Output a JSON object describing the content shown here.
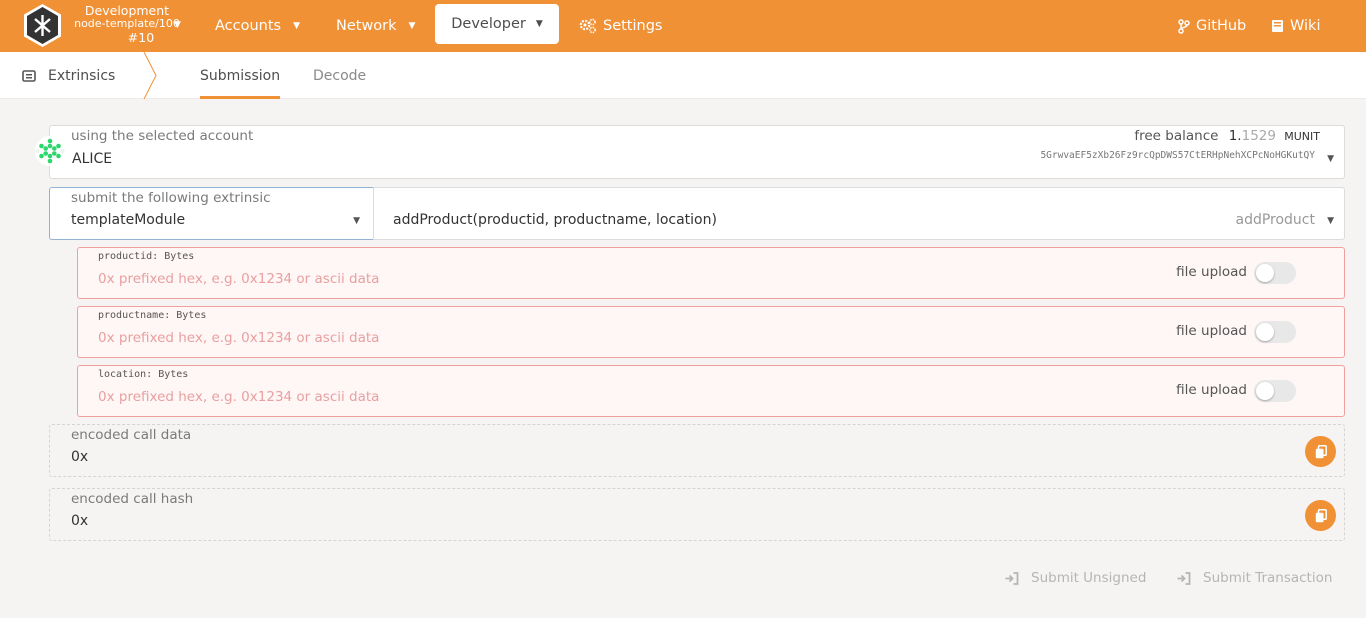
{
  "header": {
    "chain_name": "Development",
    "chain_node": "node-template/100",
    "chain_block": "#10",
    "nav": [
      {
        "label": "Accounts"
      },
      {
        "label": "Network"
      },
      {
        "label": "Developer"
      },
      {
        "label": "Settings"
      },
      {
        "label": "GitHub"
      },
      {
        "label": "Wiki"
      }
    ]
  },
  "subnav": {
    "title": "Extrinsics",
    "tabs": [
      {
        "label": "Submission",
        "active": true
      },
      {
        "label": "Decode",
        "active": false
      }
    ]
  },
  "account": {
    "label": "using the selected account",
    "name": "ALICE",
    "balance_label": "free balance",
    "balance_int": "1.",
    "balance_frac": "1529",
    "balance_unit": "MUNIT",
    "address": "5GrwvaEF5zXb26Fz9rcQpDWS57CtERHpNehXCPcNoHGKutQY"
  },
  "extrinsic": {
    "label": "submit the following extrinsic",
    "module": "templateModule",
    "call_signature": "addProduct(productid, productname, location)",
    "call": "addProduct"
  },
  "params": [
    {
      "label": "productid: Bytes",
      "placeholder": "0x prefixed hex, e.g. 0x1234 or ascii data",
      "file_upload": "file upload"
    },
    {
      "label": "productname: Bytes",
      "placeholder": "0x prefixed hex, e.g. 0x1234 or ascii data",
      "file_upload": "file upload"
    },
    {
      "label": "location: Bytes",
      "placeholder": "0x prefixed hex, e.g. 0x1234 or ascii data",
      "file_upload": "file upload"
    }
  ],
  "encoded": {
    "call_data_label": "encoded call data",
    "call_data_value": "0x",
    "call_hash_label": "encoded call hash",
    "call_hash_value": "0x"
  },
  "actions": {
    "submit_unsigned": "Submit Unsigned",
    "submit_transaction": "Submit Transaction"
  },
  "colors": {
    "brand": "#f19135",
    "error_border": "#f1a0a0"
  }
}
